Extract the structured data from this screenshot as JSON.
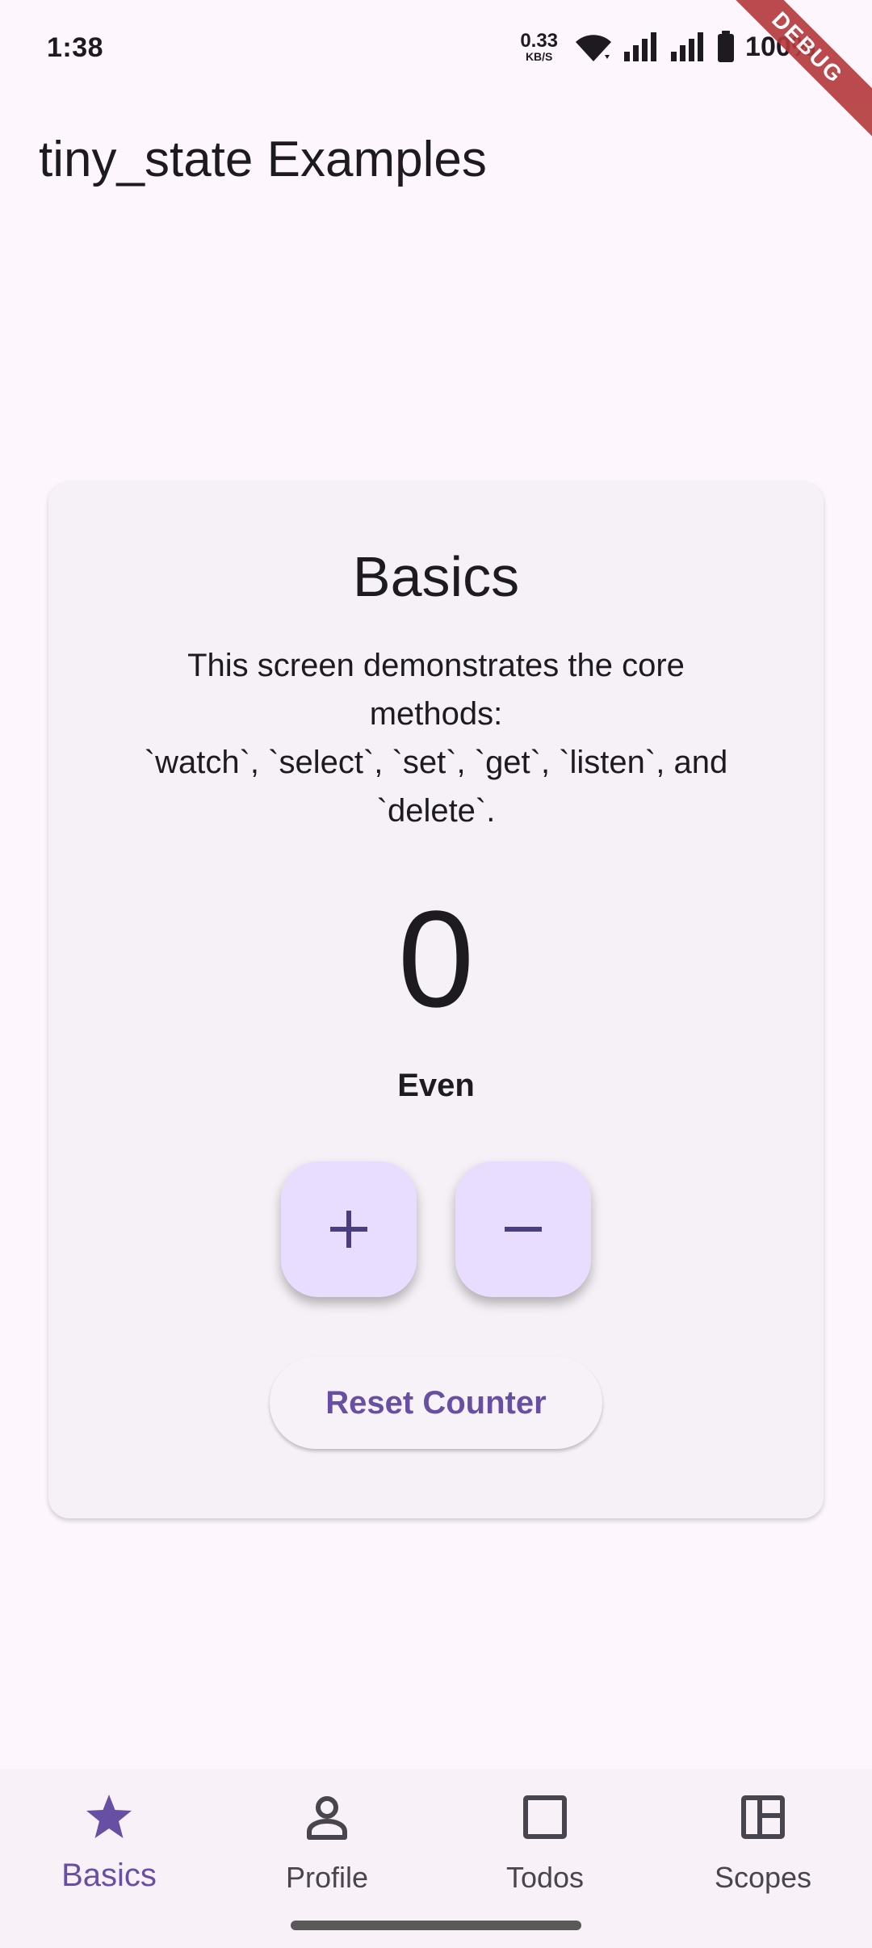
{
  "status_bar": {
    "time": "1:38",
    "net_speed_value": "0.33",
    "net_speed_unit": "KB/S",
    "battery_text": "100%",
    "icons": [
      "wifi-icon",
      "signal-icon",
      "signal-icon",
      "battery-icon"
    ]
  },
  "debug_banner": "DEBUG",
  "app_bar": {
    "title": "tiny_state Examples"
  },
  "card": {
    "title": "Basics",
    "description": "This screen demonstrates the core\nmethods:\n`watch`, `select`, `set`, `get`, `listen`, and\n`delete`.",
    "counter_value": "0",
    "parity_label": "Even",
    "increment_label": "+",
    "decrement_label": "−",
    "reset_label": "Reset Counter"
  },
  "bottom_nav": {
    "items": [
      {
        "label": "Basics",
        "icon": "star-icon",
        "active": true
      },
      {
        "label": "Profile",
        "icon": "person-icon",
        "active": false
      },
      {
        "label": "Todos",
        "icon": "square-icon",
        "active": false
      },
      {
        "label": "Scopes",
        "icon": "layout-icon",
        "active": false
      }
    ]
  },
  "colors": {
    "background": "#fdf7fd",
    "card": "#f5f1f6",
    "fab": "#e9ddff",
    "accent": "#6750a4",
    "debug_banner": "#b3383b"
  }
}
